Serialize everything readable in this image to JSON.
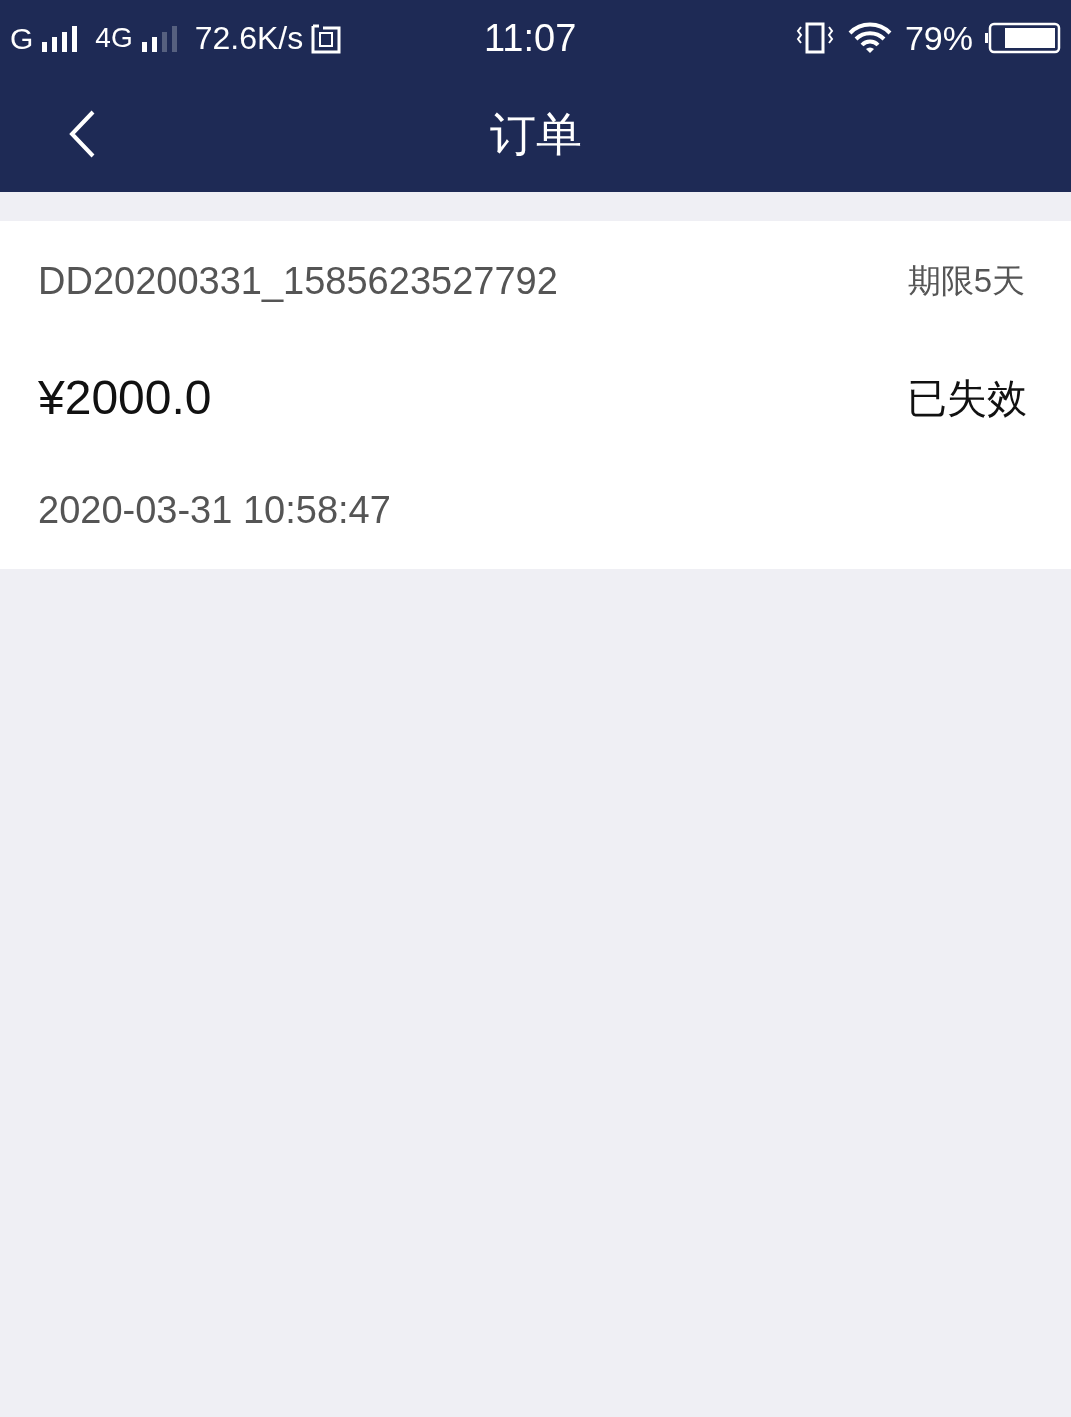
{
  "status_bar": {
    "carrier_1": "G",
    "carrier_2": "4G",
    "speed": "72.6K/s",
    "time": "11:07",
    "battery": "79%"
  },
  "nav": {
    "title": "订单"
  },
  "orders": [
    {
      "number": "DD20200331_1585623527792",
      "deadline": "期限5天",
      "amount": "¥2000.0",
      "status": "已失效",
      "date": "2020-03-31 10:58:47"
    }
  ]
}
